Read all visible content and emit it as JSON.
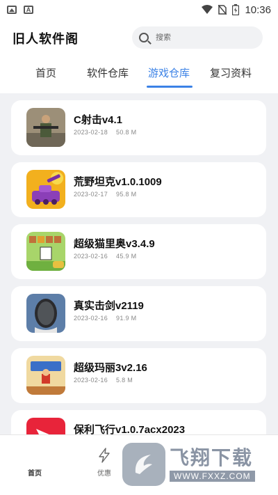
{
  "status_bar": {
    "time": "10:36"
  },
  "header": {
    "title": "旧人软件阁",
    "search_placeholder": "搜索"
  },
  "tabs": [
    {
      "label": "首页",
      "active": false
    },
    {
      "label": "软件仓库",
      "active": false
    },
    {
      "label": "游戏仓库",
      "active": true
    },
    {
      "label": "复习资料",
      "active": false
    }
  ],
  "apps": [
    {
      "name": "C射击v4.1",
      "date": "2023-02-18",
      "size": "50.8 M",
      "icon": "soldier-icon"
    },
    {
      "name": "荒野坦克v1.0.1009",
      "date": "2023-02-17",
      "size": "95.8 M",
      "icon": "tank-icon"
    },
    {
      "name": "超级猫里奥v3.4.9",
      "date": "2023-02-16",
      "size": "45.9 M",
      "icon": "cat-mario-icon"
    },
    {
      "name": "真实击剑v2119",
      "date": "2023-02-16",
      "size": "91.9 M",
      "icon": "fencing-mask-icon"
    },
    {
      "name": "超级玛丽3v2.16",
      "date": "2023-02-16",
      "size": "5.8 M",
      "icon": "super-mario-icon"
    },
    {
      "name": "保利飞行v1.0.7acx2023",
      "date": "",
      "size": "",
      "icon": "plane-icon"
    }
  ],
  "bottom_nav": [
    {
      "label": "首页",
      "icon": "home-icon"
    },
    {
      "label": "优惠",
      "icon": "lightning-icon"
    }
  ],
  "watermark": {
    "title": "飞翔下载",
    "url": "WWW.FXXZ.COM"
  },
  "colors": {
    "accent": "#3b82e6",
    "background": "#f0f1f4",
    "card": "#ffffff"
  }
}
